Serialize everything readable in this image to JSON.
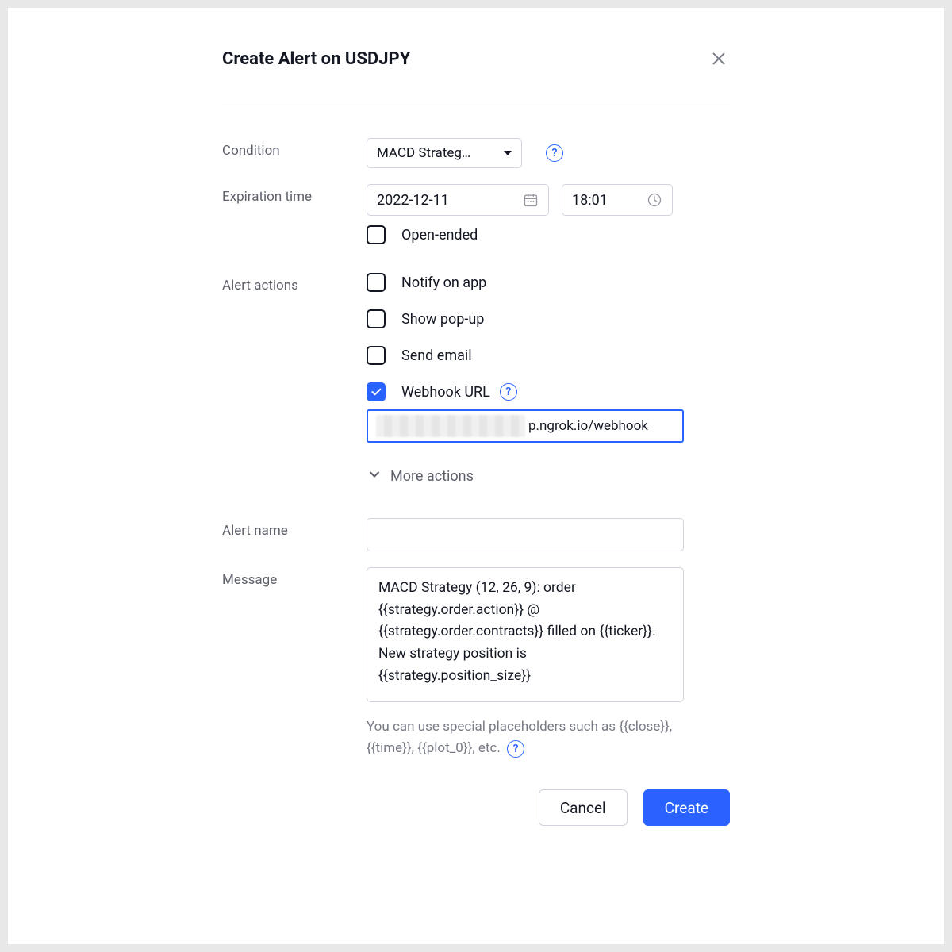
{
  "dialog": {
    "title": "Create Alert on USDJPY"
  },
  "condition": {
    "label": "Condition",
    "value": "MACD Strateg…"
  },
  "expiration": {
    "label": "Expiration time",
    "date": "2022-12-11",
    "time": "18:01",
    "open_ended_label": "Open-ended"
  },
  "actions": {
    "label": "Alert actions",
    "notify_app": "Notify on app",
    "show_popup": "Show pop-up",
    "send_email": "Send email",
    "webhook": "Webhook URL",
    "webhook_value_visible": "p.ngrok.io/webhook",
    "more": "More actions"
  },
  "alert_name": {
    "label": "Alert name",
    "value": ""
  },
  "message": {
    "label": "Message",
    "value": "MACD Strategy (12, 26, 9): order {{strategy.order.action}} @ {{strategy.order.contracts}} filled on {{ticker}}. New strategy position is {{strategy.position_size}}",
    "hint": "You can use special placeholders such as {{close}}, {{time}}, {{plot_0}}, etc."
  },
  "footer": {
    "cancel": "Cancel",
    "create": "Create"
  }
}
